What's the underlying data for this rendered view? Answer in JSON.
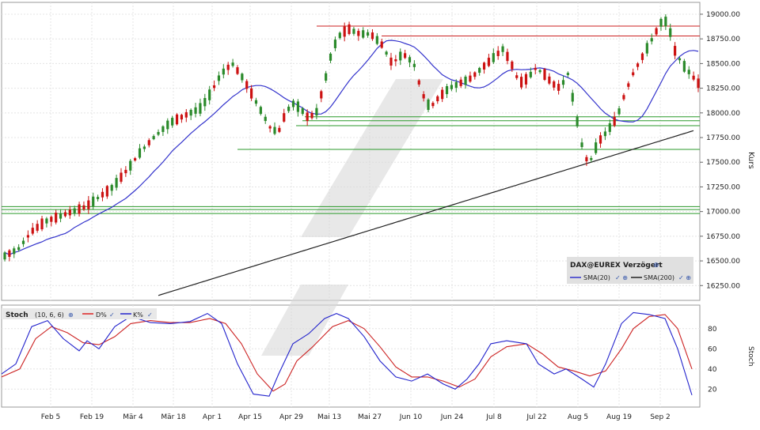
{
  "instrument_label": "DAX@EUREX Verzögert",
  "legend": [
    {
      "name": "SMA(20)",
      "color": "#3333cc"
    },
    {
      "name": "SMA(200)",
      "color": "#222222"
    }
  ],
  "stoch_title": "Stoch",
  "stoch_params": "(10, 6, 6)",
  "stoch_legend": [
    {
      "name": "D%",
      "color": "#dd2222"
    },
    {
      "name": "K%",
      "color": "#2222cc"
    }
  ],
  "colors": {
    "up": "#2b8a2b",
    "down": "#cc1111",
    "sma20": "#3333cc",
    "sma200": "#222222",
    "hline_red": "#cc2222",
    "hline_green": "#2b9a2b"
  },
  "chart_data": [
    {
      "type": "candlestick",
      "ylabel": "Kurs",
      "ylim": [
        16100,
        19120
      ],
      "yticks": [
        16250,
        16500,
        16750,
        17000,
        17250,
        17500,
        17750,
        18000,
        18250,
        18500,
        18750,
        19000
      ],
      "ytick_labels": [
        "16250.00",
        "16500.00",
        "16750.00",
        "17000.00",
        "17250.00",
        "17500.00",
        "17750.00",
        "18000.00",
        "18250.00",
        "18500.00",
        "18750.00",
        "19000.00"
      ],
      "xtick_labels": [
        "Feb 5",
        "Feb 19",
        "Mär 4",
        "Mär 18",
        "Apr 1",
        "Apr 15",
        "Apr 29",
        "Mai 13",
        "Mai 27",
        "Jun 10",
        "Jun 24",
        "Jul 8",
        "Jul 22",
        "Aug 5",
        "Aug 19",
        "Sep 2"
      ],
      "horizontal_levels": {
        "red": [
          18880,
          18780
        ],
        "green": [
          17960,
          17920,
          17870,
          17630,
          17050,
          17020,
          16980
        ]
      },
      "series": [
        {
          "name": "SMA(20)",
          "values": []
        },
        {
          "name": "SMA(200)",
          "values": []
        }
      ]
    },
    {
      "type": "line",
      "ylim": [
        0,
        100
      ],
      "yticks": [
        20,
        40,
        60,
        80
      ],
      "ylabel": "Stoch",
      "series": [
        {
          "name": "D%",
          "values": []
        },
        {
          "name": "K%",
          "values": []
        }
      ]
    }
  ]
}
